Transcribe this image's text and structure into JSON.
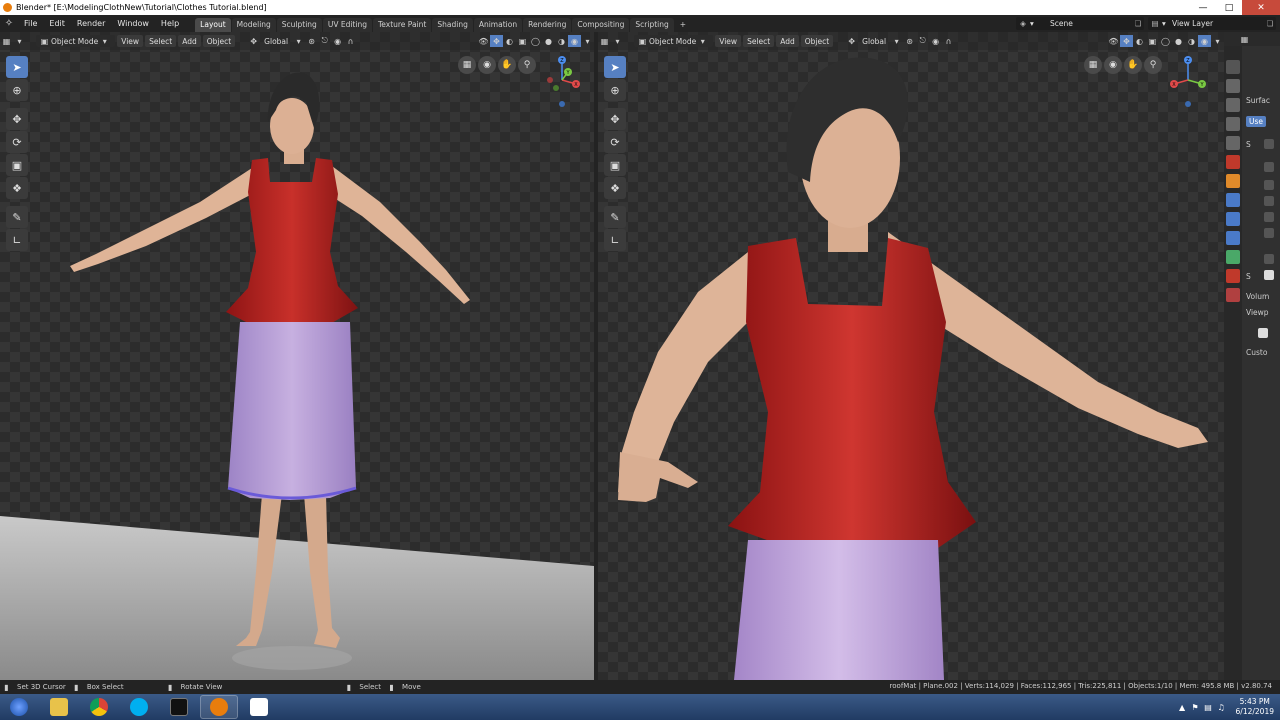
{
  "window": {
    "title": "Blender* [E:\\ModelingClothNew\\Tutorial\\Clothes Tutorial.blend]"
  },
  "menu": [
    "File",
    "Edit",
    "Render",
    "Window",
    "Help"
  ],
  "workspaces": [
    "Layout",
    "Modeling",
    "Sculpting",
    "UV Editing",
    "Texture Paint",
    "Shading",
    "Animation",
    "Rendering",
    "Compositing",
    "Scripting"
  ],
  "workspace_add": "+",
  "scene": "Scene",
  "view_layer": "View Layer",
  "viewport_header": {
    "mode": "Object Mode",
    "view": "View",
    "select": "Select",
    "add": "Add",
    "object": "Object",
    "orientation": "Global"
  },
  "gizmo_axes": {
    "x": "X",
    "y": "Y",
    "z": "Z"
  },
  "properties_panel": {
    "surface": "Surfac",
    "use": "Use",
    "s1": "S",
    "s2": "S",
    "volume": "Volum",
    "viewport": "Viewp",
    "custom": "Custo"
  },
  "status": {
    "set_cursor": "Set 3D Cursor",
    "box_select": "Box Select",
    "rotate_view": "Rotate View",
    "select": "Select",
    "move": "Move",
    "info": "roofMat | Plane.002 | Verts:114,029 | Faces:112,965 | Tris:225,811 | Objects:1/10 | Mem: 495.8 MB | v2.80.74"
  },
  "clock": {
    "time": "5:43 PM",
    "date": "6/12/2019"
  },
  "colors": {
    "active_tool": "#5680c2",
    "accent_orange": "#e87d0d",
    "top_red": "#b5221c",
    "skirt_lilac": "#b9a0d4"
  }
}
